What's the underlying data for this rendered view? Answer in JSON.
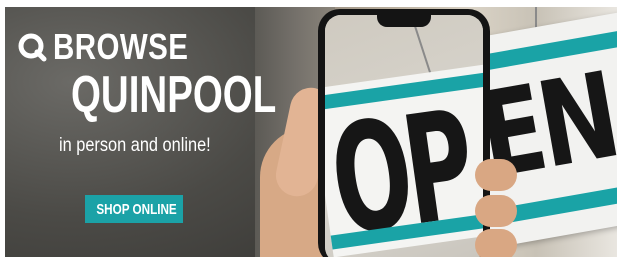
{
  "banner": {
    "brand_prefix": "BROWSE",
    "brand_name": "QUINPOOL",
    "tagline": "in person and online!",
    "cta_label": "SHOP ONLINE",
    "logo_icon": "search-q-icon",
    "sign_word_front": "OP",
    "sign_word_back": "EN",
    "colors": {
      "accent": "#1ba2a7",
      "text": "#ffffff",
      "sign_band": "#1aa3a6",
      "sign_letters": "#161616"
    }
  }
}
